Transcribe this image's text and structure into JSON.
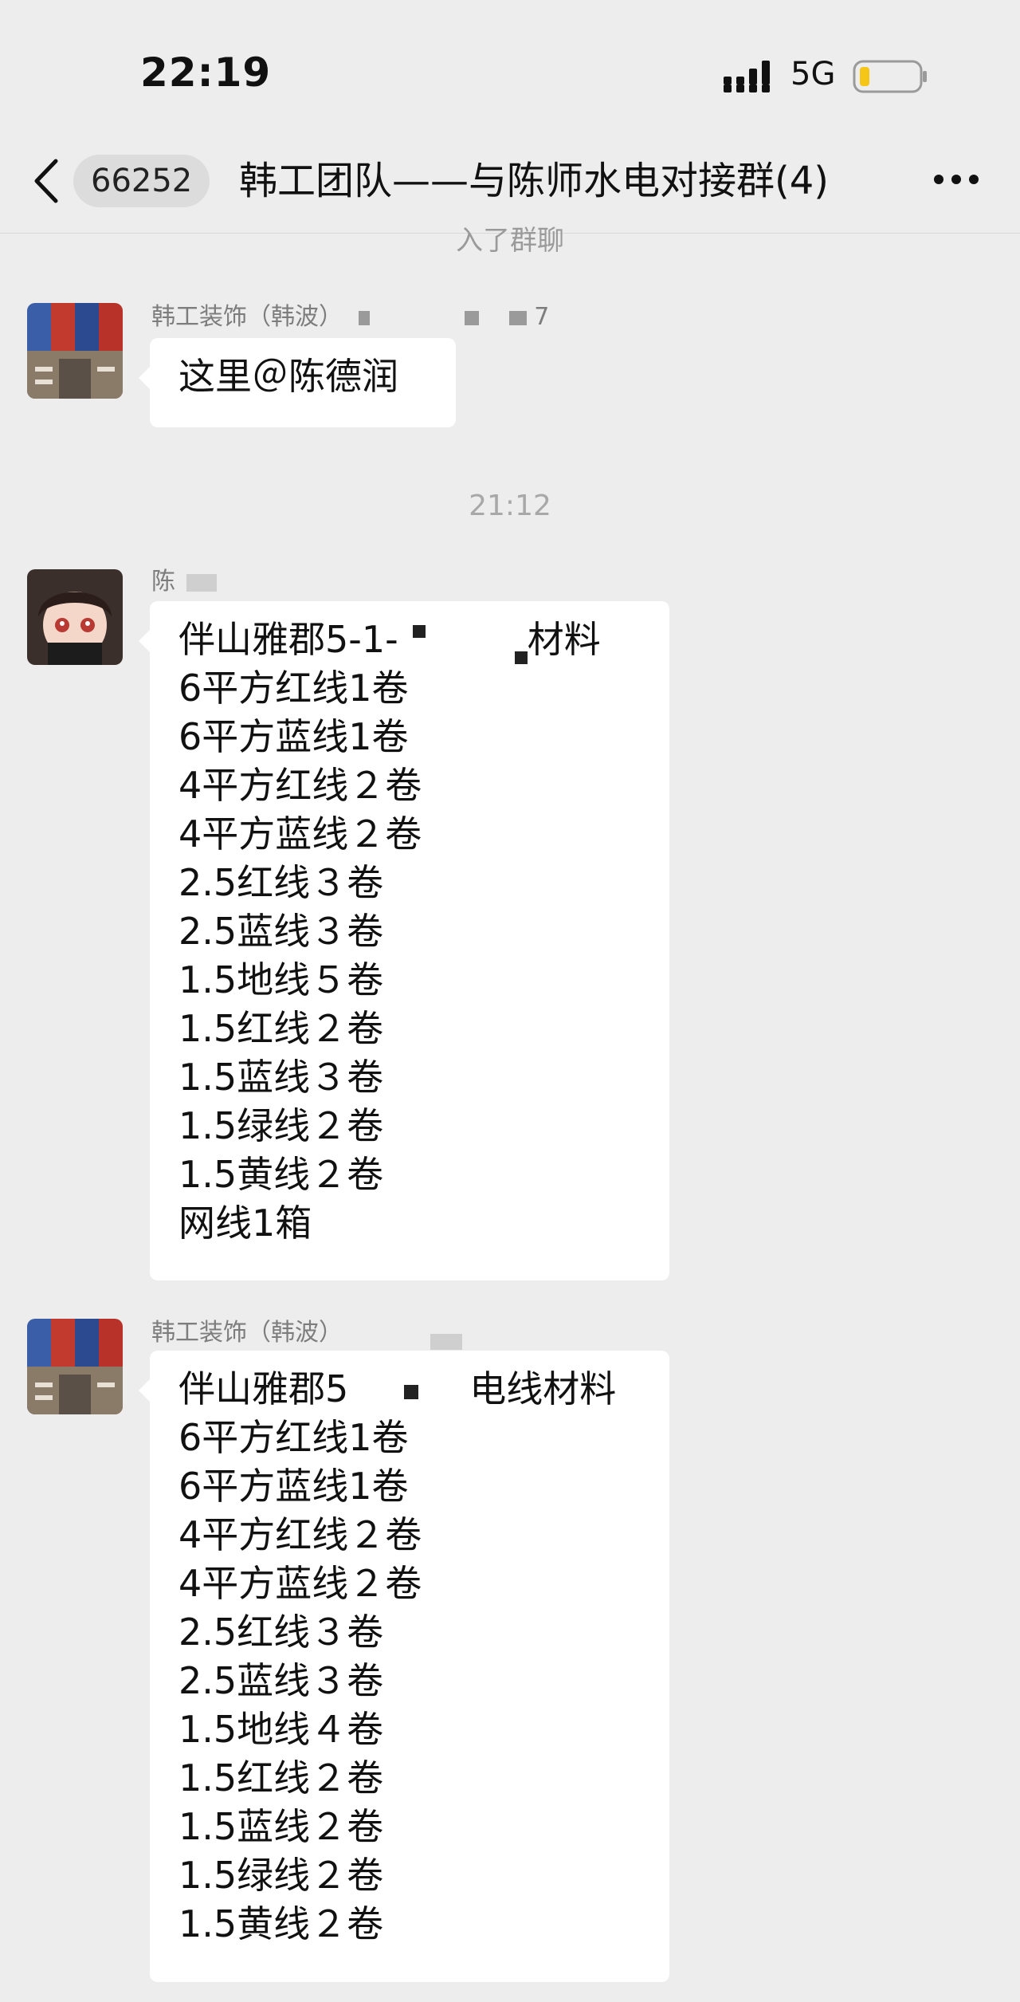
{
  "status_bar": {
    "time": "22:19",
    "network": "5G"
  },
  "nav": {
    "unread_count": "66252",
    "title": "韩工团队——与陈师水电对接群(4)"
  },
  "system_notice": "入了群聊",
  "timestamp": "21:12",
  "messages": [
    {
      "sender": "韩工装饰（韩波）",
      "sender_suffix": "7",
      "lines": [
        "这里＠陈德润"
      ]
    },
    {
      "sender": "陈",
      "lines": [
        "伴山雅郡5-1-",
        "材料",
        "6平方红线1卷",
        "6平方蓝线1卷",
        "4平方红线２卷",
        "4平方蓝线２卷",
        "2.5红线３卷",
        "2.5蓝线３卷",
        "1.5地线５卷",
        "1.5红线２卷",
        "1.5蓝线３卷",
        "1.5绿线２卷",
        "1.5黄线２卷",
        "网线1箱"
      ]
    },
    {
      "sender": "韩工装饰（韩波）",
      "lines": [
        "伴山雅郡5",
        "电线材料",
        "6平方红线1卷",
        "6平方蓝线1卷",
        "4平方红线２卷",
        "4平方蓝线２卷",
        "2.5红线３卷",
        "2.5蓝线３卷",
        "1.5地线４卷",
        "1.5红线２卷",
        "1.5蓝线２卷",
        "1.5绿线２卷",
        "1.5黄线２卷"
      ]
    }
  ],
  "colors": {
    "background": "#ededed",
    "bubble": "#ffffff",
    "meta_text": "#9a9a9a"
  }
}
